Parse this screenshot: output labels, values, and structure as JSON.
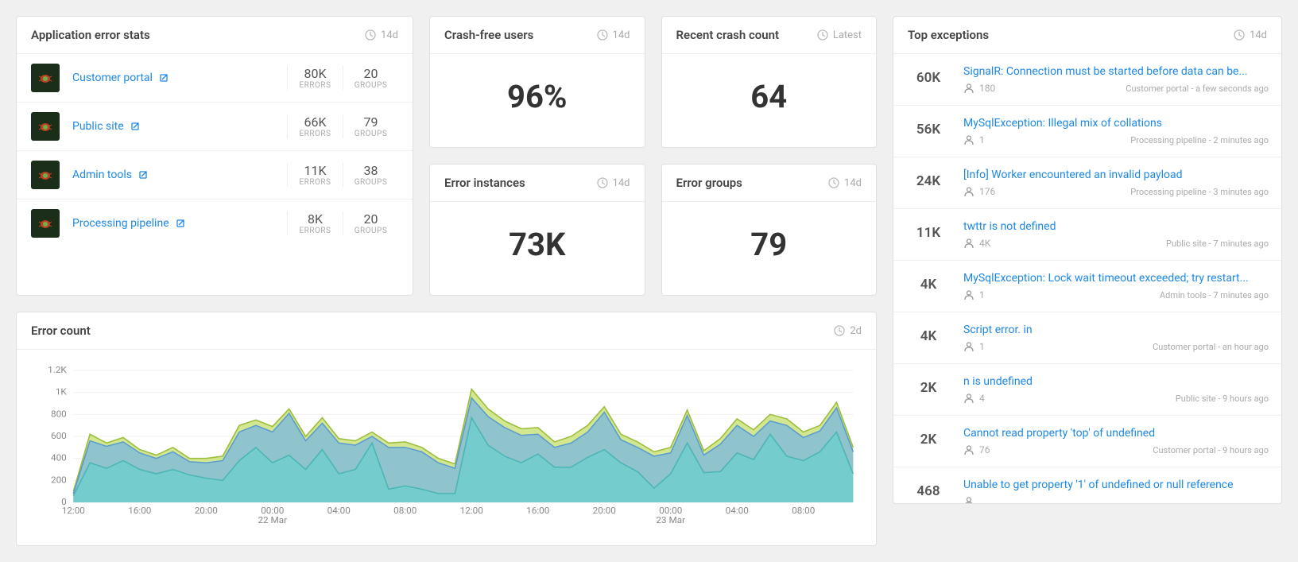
{
  "cards": {
    "app_stats": {
      "title": "Application error stats",
      "period": "14d"
    },
    "crash_free": {
      "title": "Crash-free users",
      "period": "14d",
      "value": "96%"
    },
    "recent_crash": {
      "title": "Recent crash count",
      "period": "Latest",
      "value": "64"
    },
    "err_instances": {
      "title": "Error instances",
      "period": "14d",
      "value": "73K"
    },
    "err_groups": {
      "title": "Error groups",
      "period": "14d",
      "value": "79"
    },
    "err_count": {
      "title": "Error count",
      "period": "2d"
    },
    "top_exc": {
      "title": "Top exceptions",
      "period": "14d"
    }
  },
  "labels": {
    "errors": "ERRORS",
    "groups": "GROUPS"
  },
  "apps": [
    {
      "name": "Customer portal",
      "errors": "80K",
      "groups": "20"
    },
    {
      "name": "Public site",
      "errors": "66K",
      "groups": "79"
    },
    {
      "name": "Admin tools",
      "errors": "11K",
      "groups": "38"
    },
    {
      "name": "Processing pipeline",
      "errors": "8K",
      "groups": "20"
    }
  ],
  "exceptions": [
    {
      "count": "60K",
      "title": "SignalR: Connection must be started before data can be...",
      "users": "180",
      "src": "Customer portal",
      "time": "a few seconds ago"
    },
    {
      "count": "56K",
      "title": "MySqlException: Illegal mix of collations",
      "users": "1",
      "src": "Processing pipeline",
      "time": "2 minutes ago"
    },
    {
      "count": "24K",
      "title": "[Info] Worker encountered an invalid payload",
      "users": "176",
      "src": "Processing pipeline",
      "time": "3 minutes ago"
    },
    {
      "count": "11K",
      "title": "twttr is not defined",
      "users": "4K",
      "src": "Public site",
      "time": "7 minutes ago"
    },
    {
      "count": "4K",
      "title": "MySqlException: Lock wait timeout exceeded; try restart...",
      "users": "1",
      "src": "Admin tools",
      "time": "7 minutes ago"
    },
    {
      "count": "4K",
      "title": "Script error. in",
      "users": "1",
      "src": "Customer portal",
      "time": "an hour ago"
    },
    {
      "count": "2K",
      "title": "n is undefined",
      "users": "4",
      "src": "Public site",
      "time": "9 hours ago"
    },
    {
      "count": "2K",
      "title": "Cannot read property 'top' of undefined",
      "users": "76",
      "src": "Customer portal",
      "time": "9 hours ago"
    },
    {
      "count": "468",
      "title": "Unable to get property '1' of undefined or null reference",
      "users": "",
      "src": "",
      "time": ""
    }
  ],
  "chart_data": {
    "type": "area",
    "ylabel": "",
    "xlabel": "",
    "ylim": [
      0,
      1200
    ],
    "yticks": [
      "0",
      "200",
      "400",
      "600",
      "800",
      "1K",
      "1.2K"
    ],
    "xticks": [
      "12:00",
      "16:00",
      "20:00",
      "00:00",
      "04:00",
      "08:00",
      "12:00",
      "16:00",
      "20:00",
      "00:00",
      "04:00",
      "08:00"
    ],
    "xsublabels": {
      "3": "22 Mar",
      "9": "23 Mar"
    },
    "colors": {
      "s1": "#bada55",
      "s2": "#7ab8e0",
      "s3": "#6ccfce"
    },
    "series": [
      {
        "name": "s1",
        "values": [
          100,
          620,
          540,
          590,
          480,
          430,
          500,
          400,
          400,
          420,
          700,
          750,
          690,
          850,
          600,
          770,
          580,
          560,
          640,
          540,
          550,
          500,
          400,
          350,
          1030,
          850,
          740,
          670,
          680,
          550,
          600,
          700,
          870,
          620,
          550,
          460,
          500,
          840,
          470,
          580,
          760,
          660,
          800,
          760,
          640,
          700,
          910,
          500
        ]
      },
      {
        "name": "s2",
        "values": [
          80,
          560,
          510,
          550,
          450,
          400,
          460,
          370,
          360,
          380,
          640,
          700,
          640,
          810,
          560,
          720,
          540,
          520,
          600,
          500,
          500,
          460,
          360,
          310,
          950,
          780,
          680,
          610,
          620,
          500,
          540,
          640,
          820,
          570,
          500,
          420,
          450,
          790,
          430,
          530,
          700,
          600,
          740,
          700,
          590,
          650,
          860,
          460
        ]
      },
      {
        "name": "s3",
        "values": [
          60,
          360,
          310,
          380,
          300,
          260,
          300,
          250,
          220,
          200,
          380,
          500,
          360,
          430,
          300,
          480,
          260,
          300,
          540,
          120,
          150,
          120,
          80,
          80,
          770,
          520,
          420,
          360,
          440,
          320,
          320,
          410,
          480,
          360,
          280,
          130,
          260,
          540,
          270,
          280,
          450,
          390,
          620,
          420,
          380,
          460,
          640,
          260
        ]
      }
    ]
  }
}
